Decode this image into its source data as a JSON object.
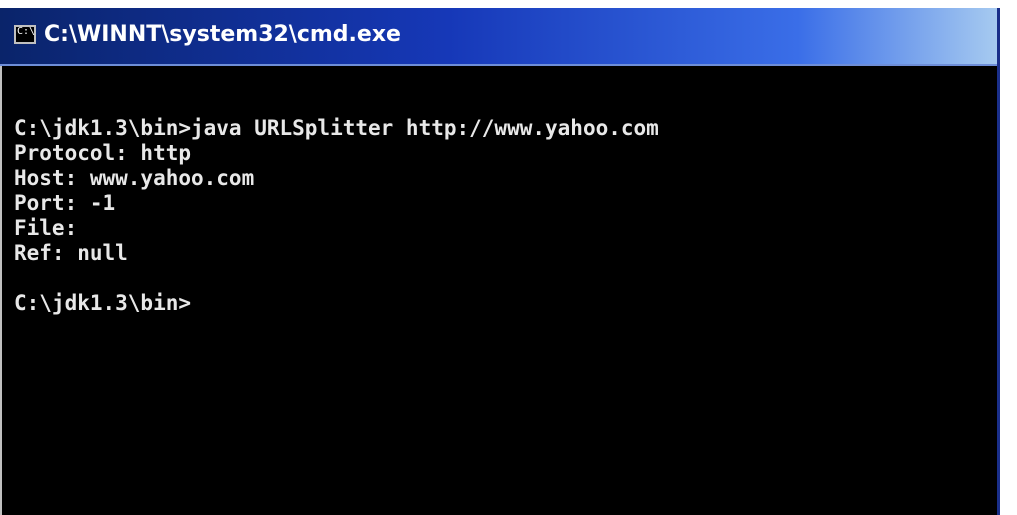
{
  "window": {
    "title": "C:\\WINNT\\system32\\cmd.exe",
    "icon": "console-icon",
    "icon_glyph": "C:\\"
  },
  "console": {
    "lines": [
      "C:\\jdk1.3\\bin>java URLSplitter http://www.yahoo.com",
      "Protocol: http",
      "Host: www.yahoo.com",
      "Port: -1",
      "File:",
      "Ref: null",
      "",
      "C:\\jdk1.3\\bin>"
    ]
  },
  "colors": {
    "background": "#000000",
    "text": "#e8e8e8",
    "titlebar_start": "#0a246a",
    "titlebar_end": "#a6caf0"
  }
}
